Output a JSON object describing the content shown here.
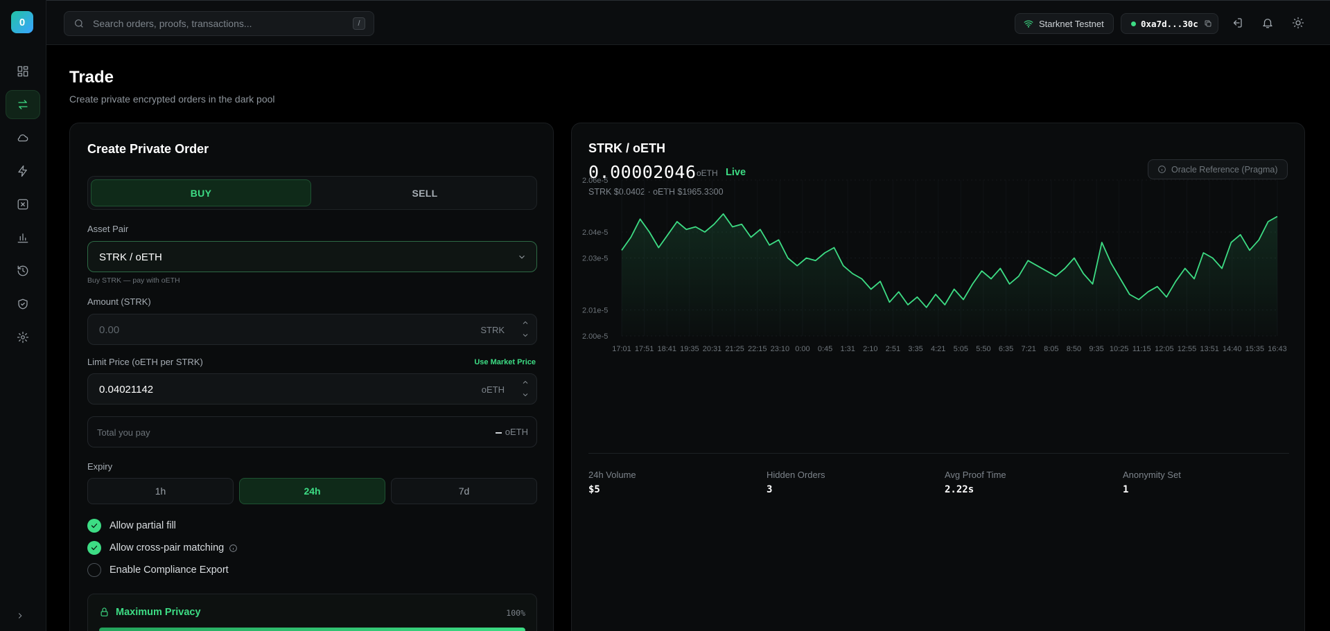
{
  "app": {
    "logo_letter": "0"
  },
  "header": {
    "search_placeholder": "Search orders, proofs, transactions...",
    "search_shortcut": "/",
    "network": "Starknet Testnet",
    "wallet": "0xa7d...30c"
  },
  "page": {
    "title": "Trade",
    "subtitle": "Create private encrypted orders in the dark pool"
  },
  "order": {
    "title": "Create Private Order",
    "buy_label": "BUY",
    "sell_label": "SELL",
    "asset_pair_label": "Asset Pair",
    "asset_pair_value": "STRK / oETH",
    "asset_pair_hint": "Buy STRK — pay with oETH",
    "amount_label": "Amount (STRK)",
    "amount_placeholder": "0.00",
    "amount_unit": "STRK",
    "limit_label": "Limit Price (oETH per STRK)",
    "use_market": "Use Market Price",
    "limit_value": "0.04021142",
    "limit_unit": "oETH",
    "total_label": "Total you pay",
    "total_unit": "oETH",
    "expiry_label": "Expiry",
    "expiry_options": [
      "1h",
      "24h",
      "7d"
    ],
    "expiry_selected": "24h",
    "options": [
      {
        "label": "Allow partial fill",
        "checked": true
      },
      {
        "label": "Allow cross-pair matching",
        "checked": true
      },
      {
        "label": "Enable Compliance Export",
        "checked": false
      }
    ],
    "privacy_title": "Maximum Privacy",
    "privacy_pct": "100%",
    "privacy_level": 1.0
  },
  "market": {
    "pair": "STRK / oETH",
    "price": "0.00002046",
    "price_unit": "oETH",
    "live": "Live",
    "sub": "STRK $0.0402 · oETH $1965.3300",
    "oracle": "Oracle Reference (Pragma)",
    "stats": [
      {
        "label": "24h Volume",
        "value": "$5"
      },
      {
        "label": "Hidden Orders",
        "value": "3"
      },
      {
        "label": "Avg Proof Time",
        "value": "2.22s"
      },
      {
        "label": "Anonymity Set",
        "value": "1"
      }
    ]
  },
  "colors": {
    "accent": "#3ddc84",
    "bg": "#000000",
    "card": "#0a0c0d"
  },
  "chart_data": {
    "type": "area",
    "title": "",
    "xlabel": "",
    "ylabel": "",
    "y_tick_labels": [
      "2.06e-5",
      "2.04e-5",
      "2.03e-5",
      "2.01e-5",
      "2.00e-5"
    ],
    "ylim": [
      2e-05,
      2.06e-05
    ],
    "x_tick_labels": [
      "17:01",
      "17:51",
      "18:41",
      "19:35",
      "20:31",
      "21:25",
      "22:15",
      "23:10",
      "0:00",
      "0:45",
      "1:31",
      "2:10",
      "2:51",
      "3:35",
      "4:21",
      "5:05",
      "5:50",
      "6:35",
      "7:21",
      "8:05",
      "8:50",
      "9:35",
      "10:25",
      "11:15",
      "12:05",
      "12:55",
      "13:51",
      "14:40",
      "15:35",
      "16:43"
    ],
    "series": [
      {
        "values": [
          2.033e-05,
          2.038e-05,
          2.045e-05,
          2.04e-05,
          2.034e-05,
          2.039e-05,
          2.044e-05,
          2.041e-05,
          2.042e-05,
          2.04e-05,
          2.043e-05,
          2.047e-05,
          2.042e-05,
          2.043e-05,
          2.038e-05,
          2.041e-05,
          2.035e-05,
          2.037e-05,
          2.03e-05,
          2.027e-05,
          2.03e-05,
          2.029e-05,
          2.032e-05,
          2.034e-05,
          2.027e-05,
          2.024e-05,
          2.022e-05,
          2.018e-05,
          2.021e-05,
          2.013e-05,
          2.017e-05,
          2.012e-05,
          2.015e-05,
          2.011e-05,
          2.016e-05,
          2.012e-05,
          2.018e-05,
          2.014e-05,
          2.02e-05,
          2.025e-05,
          2.022e-05,
          2.026e-05,
          2.02e-05,
          2.023e-05,
          2.029e-05,
          2.027e-05,
          2.025e-05,
          2.023e-05,
          2.026e-05,
          2.03e-05,
          2.024e-05,
          2.02e-05,
          2.036e-05,
          2.028e-05,
          2.022e-05,
          2.016e-05,
          2.014e-05,
          2.017e-05,
          2.019e-05,
          2.015e-05,
          2.021e-05,
          2.026e-05,
          2.022e-05,
          2.032e-05,
          2.03e-05,
          2.026e-05,
          2.036e-05,
          2.039e-05,
          2.033e-05,
          2.037e-05,
          2.044e-05,
          2.046e-05
        ]
      }
    ]
  }
}
